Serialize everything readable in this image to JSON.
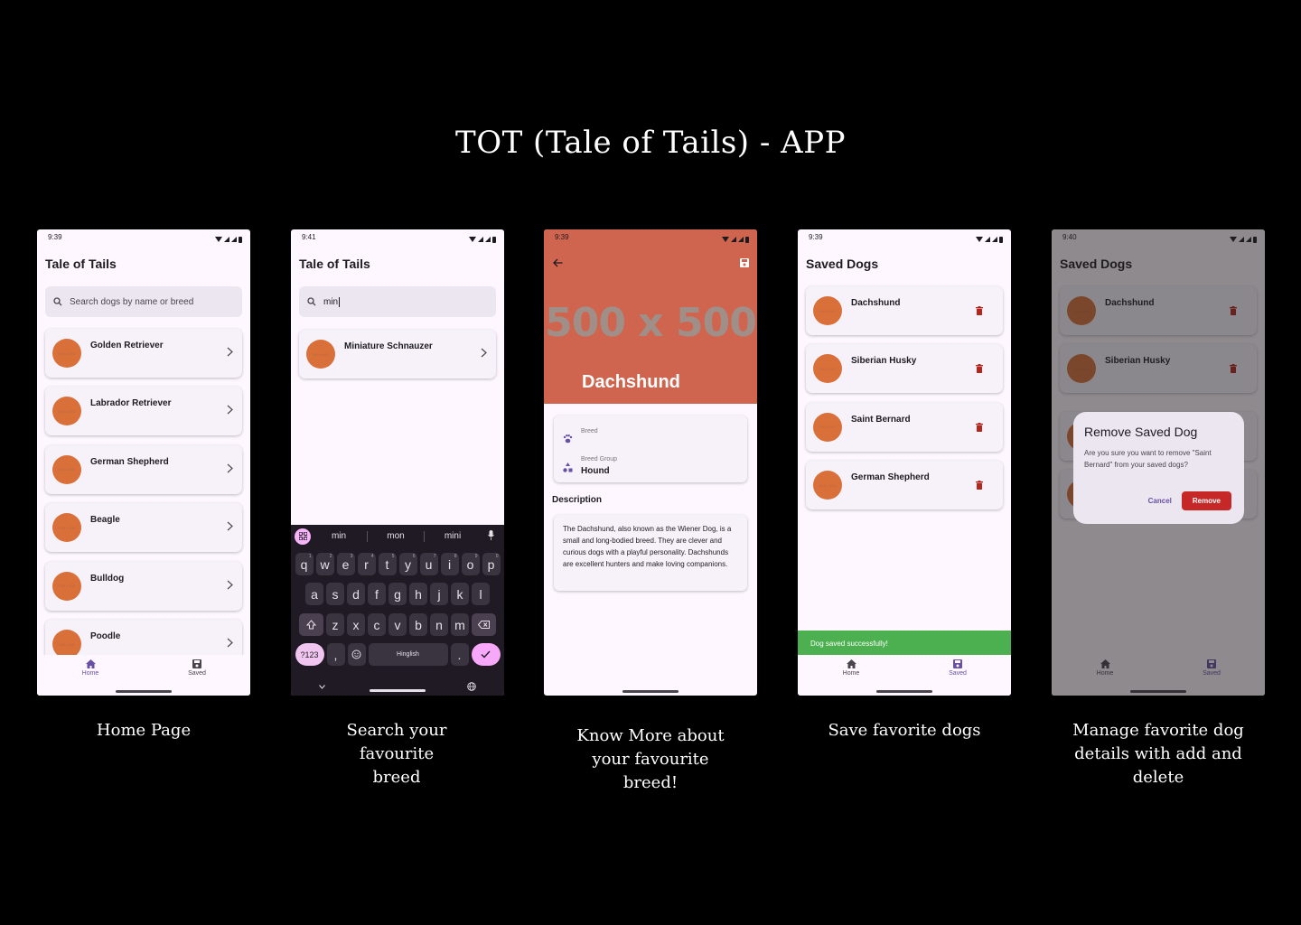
{
  "title": "TOT (Tale of Tails) - APP",
  "colors": {
    "background": "#000000",
    "surface": "#fef7ff",
    "primary": "#6750a4",
    "avatar": "#d9703a",
    "hero": "#d0654f",
    "delete": "#b3261e",
    "snackbar": "#4caf50",
    "remove_button": "#c62828"
  },
  "avatar_placeholder": "500 x 500",
  "screens": {
    "home": {
      "time": "9:39",
      "app_title": "Tale of Tails",
      "search_placeholder": "Search dogs by name or breed",
      "breeds": [
        "Golden Retriever",
        "Labrador Retriever",
        "German Shepherd",
        "Beagle",
        "Bulldog",
        "Poodle"
      ],
      "nav": {
        "home": "Home",
        "saved": "Saved"
      },
      "caption": "Home Page"
    },
    "search": {
      "time": "9:41",
      "app_title": "Tale of Tails",
      "search_value": "min",
      "results": [
        "Miniature Schnauzer"
      ],
      "keyboard": {
        "suggestions": [
          "min",
          "mon",
          "mini"
        ],
        "row1": [
          "q",
          "w",
          "e",
          "r",
          "t",
          "y",
          "u",
          "i",
          "o",
          "p"
        ],
        "row1_hints": [
          "1",
          "2",
          "3",
          "4",
          "5",
          "6",
          "7",
          "8",
          "9",
          "0"
        ],
        "row2": [
          "a",
          "s",
          "d",
          "f",
          "g",
          "h",
          "j",
          "k",
          "l"
        ],
        "row3": [
          "z",
          "x",
          "c",
          "v",
          "b",
          "n",
          "m"
        ],
        "symbols": "?123",
        "comma": ",",
        "space": "Hinglish",
        "period": "."
      },
      "caption": "Search your favourite breed"
    },
    "detail": {
      "time": "9:39",
      "placeholder": "500 x 500",
      "name": "Dachshund",
      "breed_label": "Breed",
      "breed_group_label": "Breed Group",
      "breed_group_value": "Hound",
      "description_title": "Description",
      "description": "The Dachshund, also known as the Wiener Dog, is a small and long-bodied breed. They are clever and curious dogs with a playful personality. Dachshunds are excellent hunters and make loving companions.",
      "caption": "Know More about your favourite breed!"
    },
    "saved": {
      "time": "9:39",
      "title": "Saved Dogs",
      "dogs": [
        "Dachshund",
        "Siberian Husky",
        "Saint Bernard",
        "German Shepherd"
      ],
      "snackbar": "Dog saved successfully!",
      "nav": {
        "home": "Home",
        "saved": "Saved"
      },
      "caption": "Save favorite dogs"
    },
    "manage": {
      "time": "9:40",
      "title": "Saved Dogs",
      "dogs": [
        "Dachshund",
        "Siberian Husky"
      ],
      "dialog": {
        "title": "Remove Saved Dog",
        "body": "Are you sure you want to remove \"Saint Bernard\" from your saved dogs?",
        "cancel": "Cancel",
        "remove": "Remove"
      },
      "nav": {
        "home": "Home",
        "saved": "Saved"
      },
      "caption": "Manage favorite dog details with add and delete"
    }
  }
}
